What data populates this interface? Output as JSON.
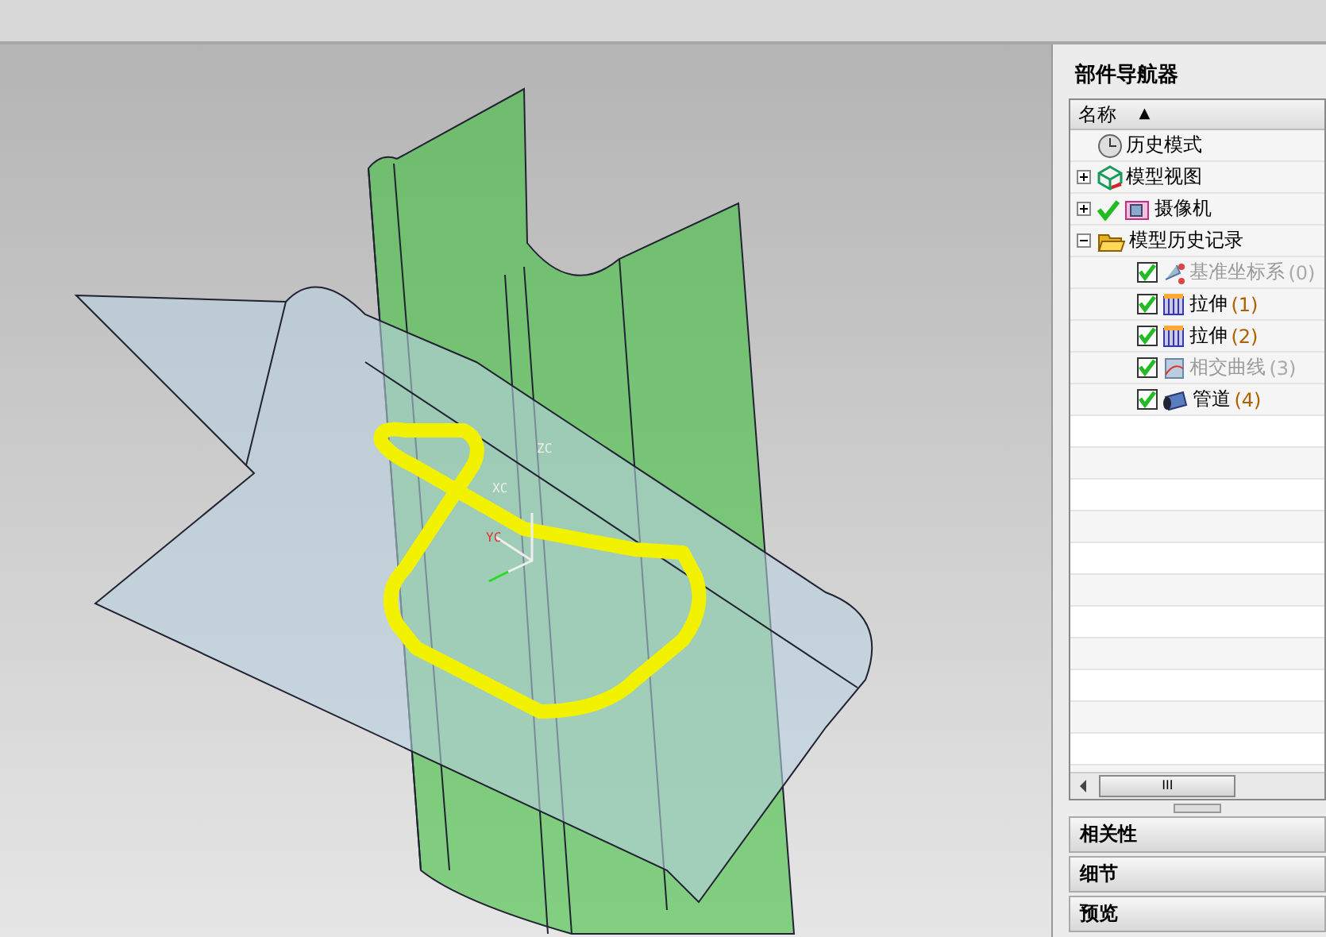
{
  "viewport": {
    "axis_labels": [
      {
        "kind": "z",
        "text": "ZC"
      },
      {
        "kind": "x",
        "text": "XC"
      },
      {
        "kind": "y",
        "text": "YC"
      }
    ]
  },
  "navigator": {
    "title": "部件导航器",
    "column": {
      "label": "名称",
      "sort_arrow": "▲"
    },
    "tree": [
      {
        "label": "历史模式",
        "kind": "clock"
      },
      {
        "label": "模型视图",
        "kind": "cube",
        "expanded": false
      },
      {
        "label": "摄像机",
        "kind": "camera",
        "expanded": false,
        "visible_check": true
      },
      {
        "label": "模型历史记录",
        "kind": "folder",
        "expanded": true,
        "children": [
          {
            "label": "基准坐标系",
            "count": "(0)",
            "kind": "csys",
            "checked": true,
            "dimmed": true
          },
          {
            "label": "拉伸",
            "count": "(1)",
            "kind": "extrude",
            "checked": true,
            "dimmed": false
          },
          {
            "label": "拉伸",
            "count": "(2)",
            "kind": "extrude",
            "checked": true,
            "dimmed": false
          },
          {
            "label": "相交曲线",
            "count": "(3)",
            "kind": "curve",
            "checked": true,
            "dimmed": true
          },
          {
            "label": "管道",
            "count": "(4)",
            "kind": "tube",
            "checked": true,
            "dimmed": false
          }
        ]
      }
    ],
    "scrollbar_grip": "III",
    "sections": [
      {
        "label": "相关性"
      },
      {
        "label": "细节"
      },
      {
        "label": "预览"
      }
    ]
  }
}
